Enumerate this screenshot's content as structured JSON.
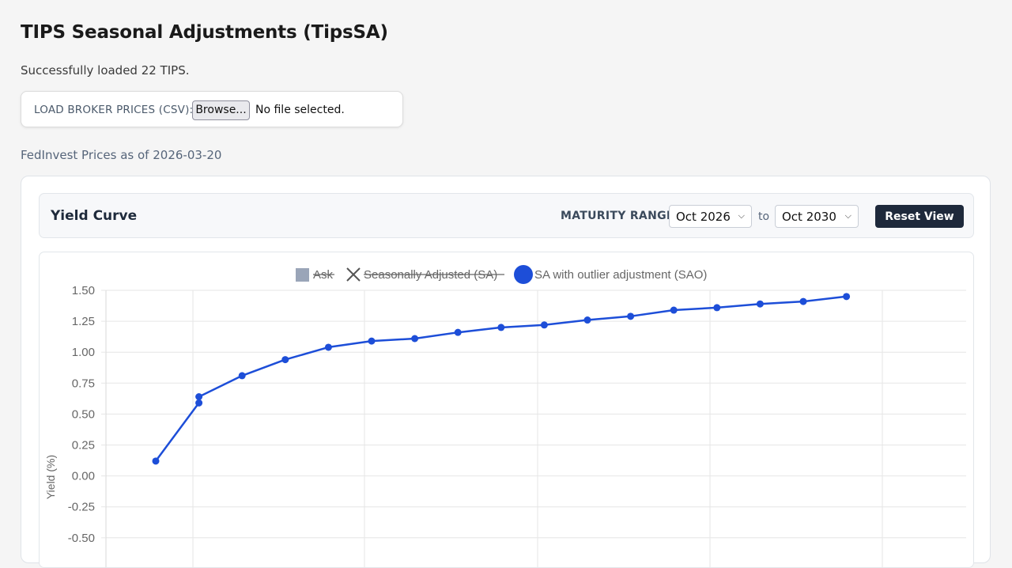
{
  "page": {
    "title": "TIPS Seasonal Adjustments (TipsSA)",
    "status": "Successfully loaded 22 TIPS.",
    "fedinvest": "FedInvest Prices as of 2026-03-20"
  },
  "upload": {
    "label": "LOAD BROKER PRICES (CSV):",
    "browse_label": "Browse...",
    "file_status": "No file selected."
  },
  "yield_curve": {
    "title": "Yield Curve",
    "range_label": "MATURITY RANGE:",
    "from_value": "Oct 2026",
    "to_label": "to",
    "to_value": "Oct 2030",
    "reset_label": "Reset View"
  },
  "colors": {
    "accent": "#1d4ed8",
    "dark_button": "#1e293b",
    "ask_legend": "#9aa5b8"
  },
  "chart_data": {
    "type": "line",
    "ylabel": "Yield (%)",
    "yticks": [
      "1.50",
      "1.25",
      "1.00",
      "0.75",
      "0.50",
      "0.25",
      "0.00",
      "-0.25",
      "-0.50"
    ],
    "ylim_visible": [
      -0.5,
      1.5
    ],
    "grid": true,
    "legend": {
      "placement": "top",
      "items": [
        {
          "label": "Ask",
          "hidden": true,
          "marker": "square"
        },
        {
          "label": "Seasonally Adjusted (SA)",
          "hidden": true,
          "marker": "cross"
        },
        {
          "label": "SA with outlier adjustment (SAO)",
          "hidden": false,
          "marker": "circle"
        }
      ]
    },
    "series": [
      {
        "name": "SA with outlier adjustment (SAO)",
        "color": "#1d4ed8",
        "points": [
          {
            "x": 0.0,
            "y": 0.12
          },
          {
            "x": 1.0,
            "y": 0.59
          },
          {
            "x": 1.0,
            "y": 0.64
          },
          {
            "x": 2.0,
            "y": 0.81
          },
          {
            "x": 3.0,
            "y": 0.94
          },
          {
            "x": 4.0,
            "y": 1.04
          },
          {
            "x": 5.0,
            "y": 1.09
          },
          {
            "x": 6.0,
            "y": 1.11
          },
          {
            "x": 7.0,
            "y": 1.16
          },
          {
            "x": 8.0,
            "y": 1.2
          },
          {
            "x": 9.0,
            "y": 1.22
          },
          {
            "x": 10.0,
            "y": 1.26
          },
          {
            "x": 11.0,
            "y": 1.29
          },
          {
            "x": 12.0,
            "y": 1.34
          },
          {
            "x": 13.0,
            "y": 1.36
          },
          {
            "x": 14.0,
            "y": 1.39
          },
          {
            "x": 15.0,
            "y": 1.41
          },
          {
            "x": 16.0,
            "y": 1.45
          }
        ]
      }
    ]
  }
}
